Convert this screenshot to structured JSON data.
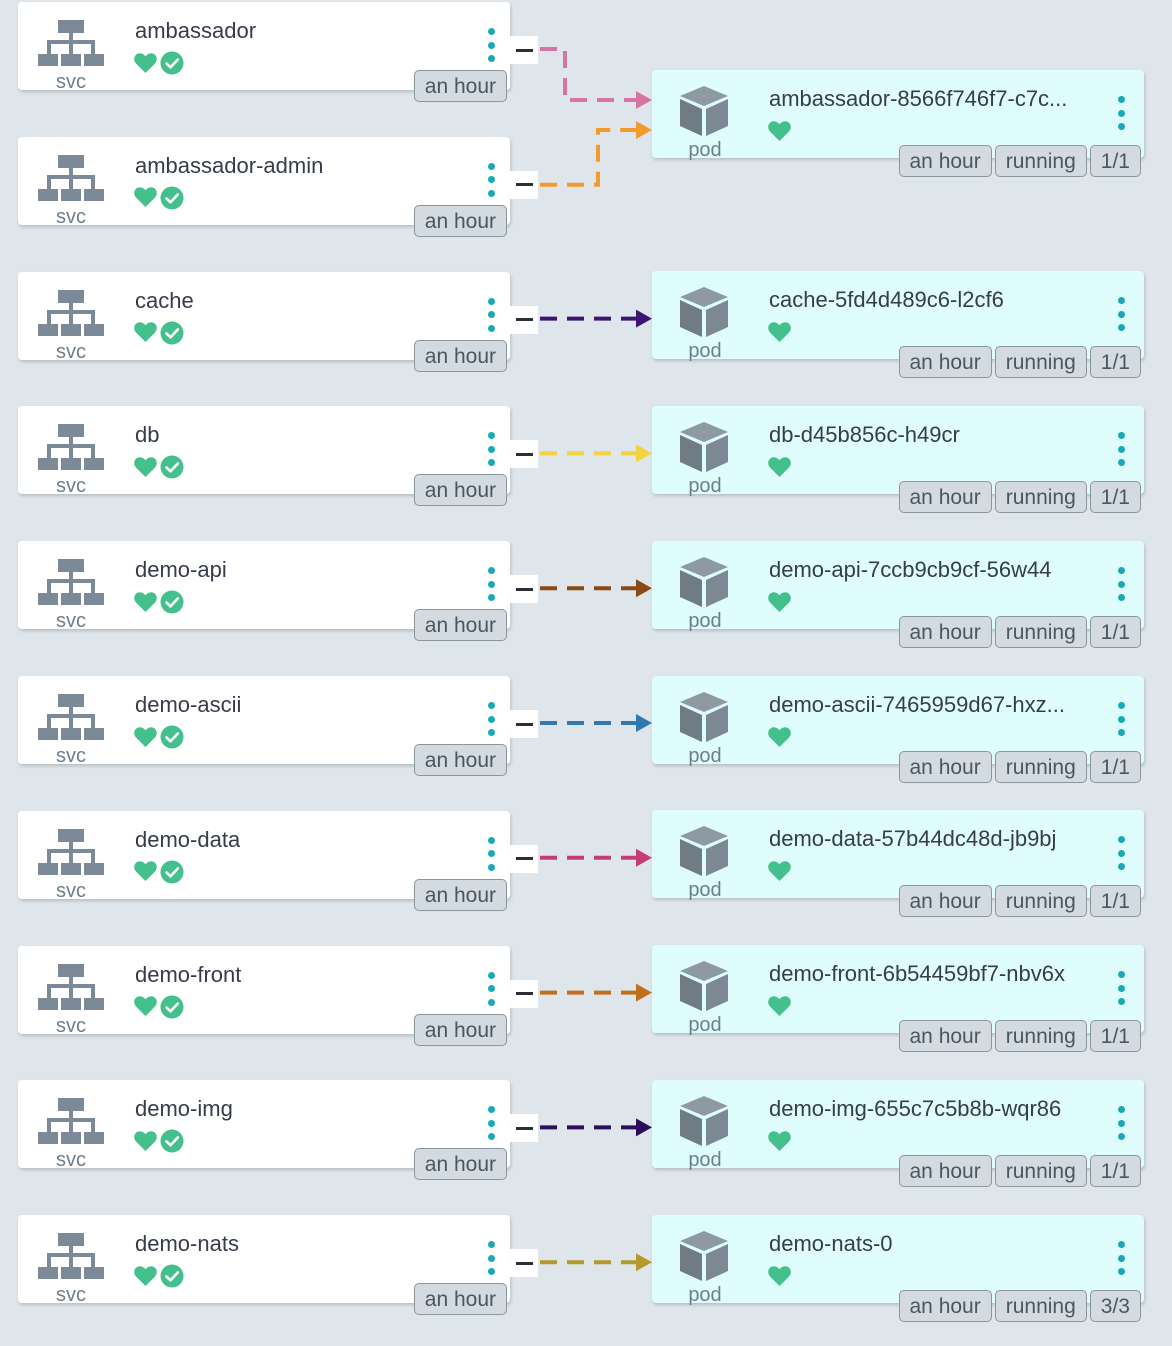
{
  "services": [
    {
      "name": "ambassador",
      "kind": "svc",
      "age": "an hour"
    },
    {
      "name": "ambassador-admin",
      "kind": "svc",
      "age": "an hour"
    },
    {
      "name": "cache",
      "kind": "svc",
      "age": "an hour"
    },
    {
      "name": "db",
      "kind": "svc",
      "age": "an hour"
    },
    {
      "name": "demo-api",
      "kind": "svc",
      "age": "an hour"
    },
    {
      "name": "demo-ascii",
      "kind": "svc",
      "age": "an hour"
    },
    {
      "name": "demo-data",
      "kind": "svc",
      "age": "an hour"
    },
    {
      "name": "demo-front",
      "kind": "svc",
      "age": "an hour"
    },
    {
      "name": "demo-img",
      "kind": "svc",
      "age": "an hour"
    },
    {
      "name": "demo-nats",
      "kind": "svc",
      "age": "an hour"
    }
  ],
  "pods": [
    {
      "name": "ambassador-8566f746f7-c7c...",
      "kind": "pod",
      "age": "an hour",
      "status": "running",
      "ready": "1/1"
    },
    {
      "name": "cache-5fd4d489c6-l2cf6",
      "kind": "pod",
      "age": "an hour",
      "status": "running",
      "ready": "1/1"
    },
    {
      "name": "db-d45b856c-h49cr",
      "kind": "pod",
      "age": "an hour",
      "status": "running",
      "ready": "1/1"
    },
    {
      "name": "demo-api-7ccb9cb9cf-56w44",
      "kind": "pod",
      "age": "an hour",
      "status": "running",
      "ready": "1/1"
    },
    {
      "name": "demo-ascii-7465959d67-hxz...",
      "kind": "pod",
      "age": "an hour",
      "status": "running",
      "ready": "1/1"
    },
    {
      "name": "demo-data-57b44dc48d-jb9bj",
      "kind": "pod",
      "age": "an hour",
      "status": "running",
      "ready": "1/1"
    },
    {
      "name": "demo-front-6b54459bf7-nbv6x",
      "kind": "pod",
      "age": "an hour",
      "status": "running",
      "ready": "1/1"
    },
    {
      "name": "demo-img-655c7c5b8b-wqr86",
      "kind": "pod",
      "age": "an hour",
      "status": "running",
      "ready": "1/1"
    },
    {
      "name": "demo-nats-0",
      "kind": "pod",
      "age": "an hour",
      "status": "running",
      "ready": "3/3"
    }
  ],
  "edges": [
    {
      "from": "ambassador",
      "to": "ambassador-8566f746f7-c7c...",
      "color": "#d873a6"
    },
    {
      "from": "ambassador-admin",
      "to": "ambassador-8566f746f7-c7c...",
      "color": "#f39a2f"
    },
    {
      "from": "cache",
      "to": "cache-5fd4d489c6-l2cf6",
      "color": "#3d1675"
    },
    {
      "from": "db",
      "to": "db-d45b856c-h49cr",
      "color": "#f2d43e"
    },
    {
      "from": "demo-api",
      "to": "demo-api-7ccb9cb9cf-56w44",
      "color": "#8a4a14"
    },
    {
      "from": "demo-ascii",
      "to": "demo-ascii-7465959d67-hxz...",
      "color": "#2f78b0"
    },
    {
      "from": "demo-data",
      "to": "demo-data-57b44dc48d-jb9bj",
      "color": "#c83a78"
    },
    {
      "from": "demo-front",
      "to": "demo-front-6b54459bf7-nbv6x",
      "color": "#c0701c"
    },
    {
      "from": "demo-img",
      "to": "demo-img-655c7c5b8b-wqr86",
      "color": "#2a0e5c"
    },
    {
      "from": "demo-nats",
      "to": "demo-nats-0",
      "color": "#b49a2a"
    }
  ],
  "colors": {
    "health": "#43c08c",
    "menu": "#18a9b8",
    "svc_icon": "#7b8a96",
    "pod_bg": "#e0fdfd"
  },
  "icons": {
    "service": "sitemap-icon",
    "pod": "cube-icon",
    "health": "heart-icon",
    "synced": "check-circle-icon",
    "menu": "vertical-dots-icon"
  }
}
